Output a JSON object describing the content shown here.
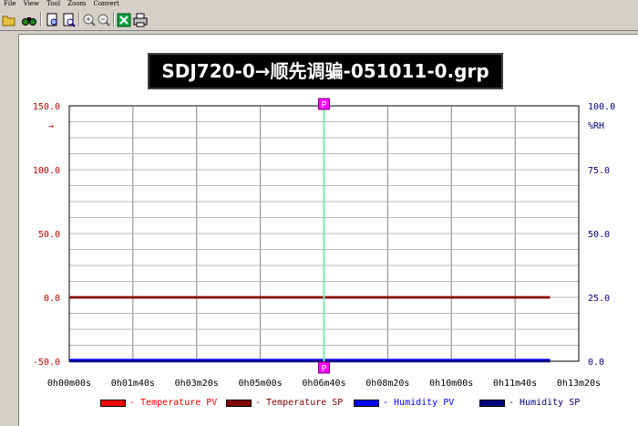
{
  "menu": [
    "File",
    "View",
    "Tool",
    "Zoom",
    "Convert"
  ],
  "toolbar": {
    "icons": [
      "open-folder-icon",
      "binoculars-icon",
      "document-preview-icon",
      "document-search-icon",
      "zoom-in-icon",
      "zoom-out-icon",
      "excel-export-icon",
      "print-icon"
    ]
  },
  "chart_title": "SDJ720-0→顺先调骗-051011-0.grp",
  "chart_data": {
    "type": "line",
    "title": "SDJ720-0→顺先调骗-051011-0.grp",
    "x_ticks": [
      "0h00m00s",
      "0h01m40s",
      "0h03m20s",
      "0h05m00s",
      "0h06m40s",
      "0h08m20s",
      "0h10m00s",
      "0h11m40s",
      "0h13m20s"
    ],
    "x_range_seconds": [
      0,
      800
    ],
    "y_left": {
      "ticks": [
        "150.0",
        "100.0",
        "50.0",
        "0.0",
        "-50.0"
      ],
      "range": [
        -50,
        150
      ],
      "unit_label": "→",
      "color": "#c00000"
    },
    "y_right": {
      "ticks": [
        "100.0",
        "75.0",
        "50.0",
        "25.0",
        "0.0"
      ],
      "range": [
        0,
        100
      ],
      "unit_label": "%RH",
      "color": "#000080"
    },
    "grid": true,
    "marker": {
      "label": "P",
      "x_seconds": 400,
      "color": "#ff00ff",
      "line_color": "#80e8b0"
    },
    "series": [
      {
        "name": "Temperature PV",
        "axis": "left",
        "color": "#ff0000",
        "x": [
          0,
          755
        ],
        "values": [
          0,
          0
        ]
      },
      {
        "name": "Temperature SP",
        "axis": "left",
        "color": "#800000",
        "x": [
          0,
          755
        ],
        "values": [
          0,
          0
        ]
      },
      {
        "name": "Humidity PV",
        "axis": "right",
        "color": "#0000ff",
        "x": [
          0,
          755
        ],
        "values": [
          0.5,
          0.5
        ]
      },
      {
        "name": "Humidity SP",
        "axis": "right",
        "color": "#000080",
        "x": [
          0,
          755
        ],
        "values": [
          0,
          0
        ]
      }
    ],
    "legend_position": "bottom"
  },
  "legend": [
    {
      "label": "- Temperature PV",
      "color": "#ff0000"
    },
    {
      "label": "- Temperature SP",
      "color": "#800000"
    },
    {
      "label": "- Humidity PV",
      "color": "#0000ff"
    },
    {
      "label": "- Humidity SP",
      "color": "#000080"
    }
  ]
}
